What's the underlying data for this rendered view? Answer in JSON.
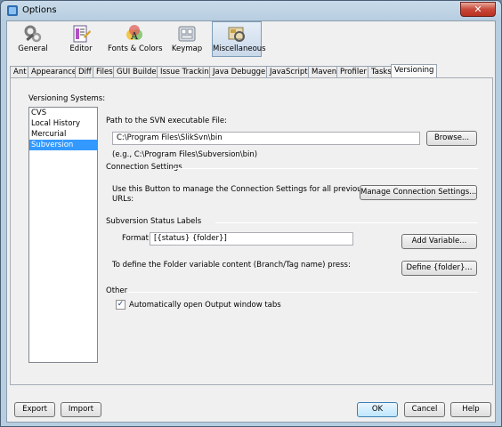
{
  "window": {
    "title": "Options",
    "close_glyph": "✕"
  },
  "categories": [
    {
      "label": "General",
      "icon": "wrench-gears-icon"
    },
    {
      "label": "Editor",
      "icon": "editor-document-icon"
    },
    {
      "label": "Fonts & Colors",
      "icon": "fonts-colors-icon"
    },
    {
      "label": "Keymap",
      "icon": "keyboard-icon"
    },
    {
      "label": "Miscellaneous",
      "icon": "misc-icon",
      "selected": true
    }
  ],
  "tabs": [
    "Ant",
    "Appearance",
    "Diff",
    "Files",
    "GUI Builder",
    "Issue Tracking",
    "Java Debugger",
    "JavaScript",
    "Maven",
    "Profiler",
    "Tasks",
    "Versioning"
  ],
  "active_tab": "Versioning",
  "versioning": {
    "systems_label": "Versioning Systems:",
    "systems": [
      "CVS",
      "Local History",
      "Mercurial",
      "Subversion"
    ],
    "selected_system": "Subversion",
    "svn_path_label": "Path to the SVN executable File:",
    "svn_path_value": "C:\\Program Files\\SlikSvn\\bin",
    "browse_label": "Browse...",
    "path_example": "(e.g., C:\\Program Files\\Subversion\\bin)",
    "connection_heading": "Connection Settings",
    "connection_desc_line1": "Use this Button to manage the Connection Settings for all previously used",
    "connection_desc_line2": "URLs:",
    "manage_connection_label": "Manage Connection Settings...",
    "status_labels_heading": "Subversion Status Labels",
    "format_label": "Format:",
    "format_value": "[{status} {folder}]",
    "add_variable_label": "Add Variable...",
    "folder_desc": "To define the Folder variable content (Branch/Tag name) press:",
    "define_folder_label": "Define {folder}...",
    "other_heading": "Other",
    "auto_open_label": "Automatically open Output window tabs",
    "auto_open_checked": true
  },
  "footer": {
    "export_label": "Export",
    "import_label": "Import",
    "ok_label": "OK",
    "cancel_label": "Cancel",
    "help_label": "Help"
  }
}
